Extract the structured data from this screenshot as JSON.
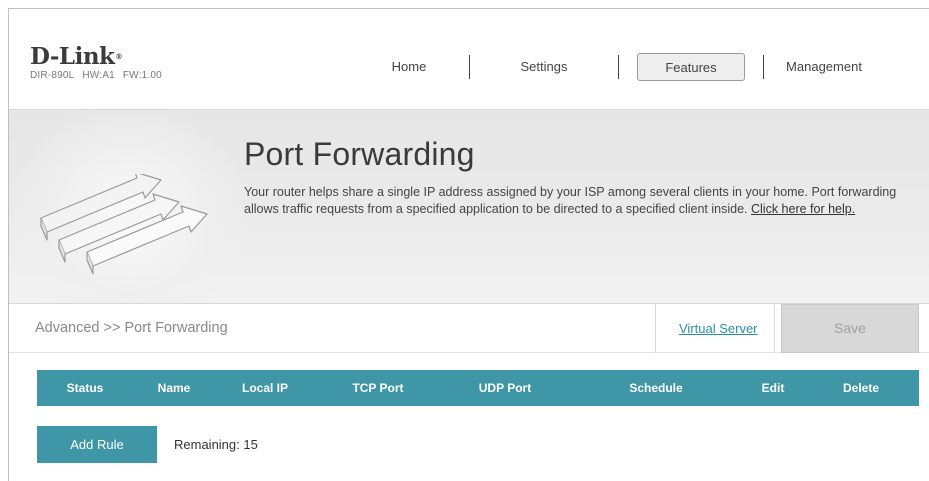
{
  "header": {
    "brand": "D-Link",
    "brand_mark": "®",
    "model": "DIR-890L",
    "hw": "HW:A1",
    "fw": "FW:1.00"
  },
  "nav": {
    "home": "Home",
    "settings": "Settings",
    "features": "Features",
    "management": "Management",
    "active": "Features"
  },
  "banner": {
    "title": "Port Forwarding",
    "description": "Your router helps share a single IP address assigned by your ISP among several clients in your home. Port forwarding allows traffic requests from a specified application to be directed to a specified client inside.",
    "help_link": "Click here for help."
  },
  "section": {
    "breadcrumb": "Advanced >> Port Forwarding",
    "virtual_server_link": "Virtual Server",
    "save_label": "Save"
  },
  "table": {
    "columns": [
      "Status",
      "Name",
      "Local IP",
      "TCP Port",
      "UDP Port",
      "Schedule",
      "Edit",
      "Delete"
    ],
    "rows": []
  },
  "footer": {
    "add_rule_label": "Add Rule",
    "remaining": "Remaining: 15"
  },
  "colors": {
    "accent": "#3e96a6",
    "link": "#2a8ea9",
    "save_disabled_bg": "#d8d8d8"
  }
}
